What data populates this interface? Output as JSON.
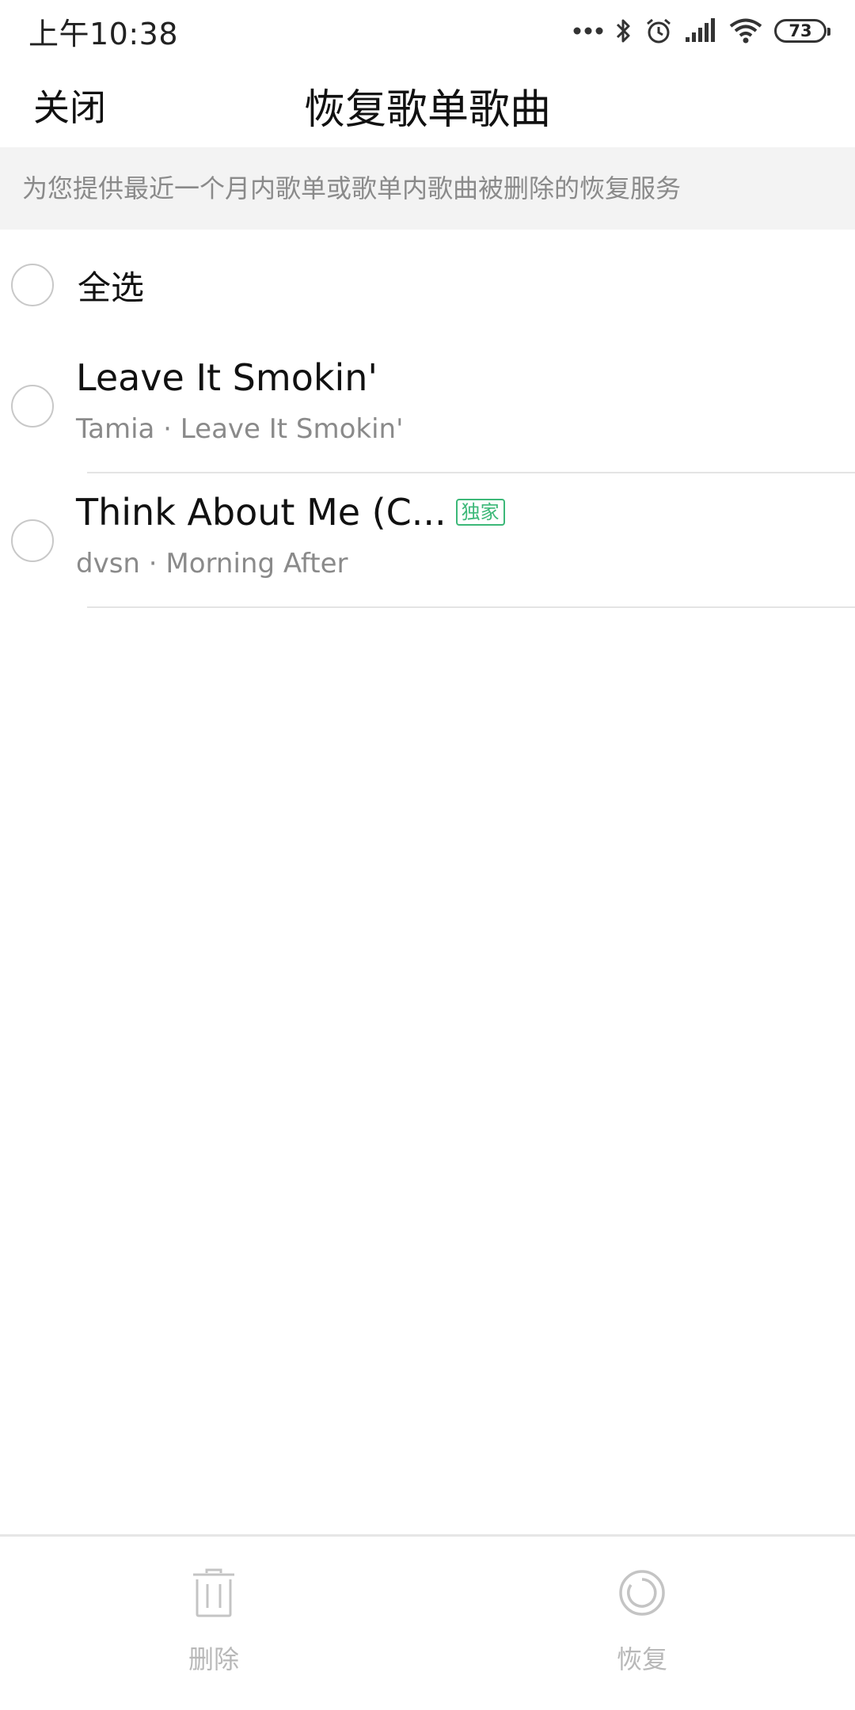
{
  "status_bar": {
    "time": "上午10:38",
    "battery": "73"
  },
  "header": {
    "close_label": "关闭",
    "title": "恢复歌单歌曲"
  },
  "notice": "为您提供最近一个月内歌单或歌单内歌曲被删除的恢复服务",
  "select_all_label": "全选",
  "songs": [
    {
      "title": "Leave It Smokin'",
      "subtitle": "Tamia · Leave It Smokin'",
      "badge": ""
    },
    {
      "title": "Think About Me (C...",
      "subtitle": "dvsn · Morning After",
      "badge": "独家"
    }
  ],
  "bottom_bar": {
    "delete_label": "删除",
    "restore_label": "恢复"
  },
  "colors": {
    "accent_badge": "#3cb878",
    "notice_bg": "#f3f3f3",
    "disabled_text": "#b8b8b8"
  }
}
